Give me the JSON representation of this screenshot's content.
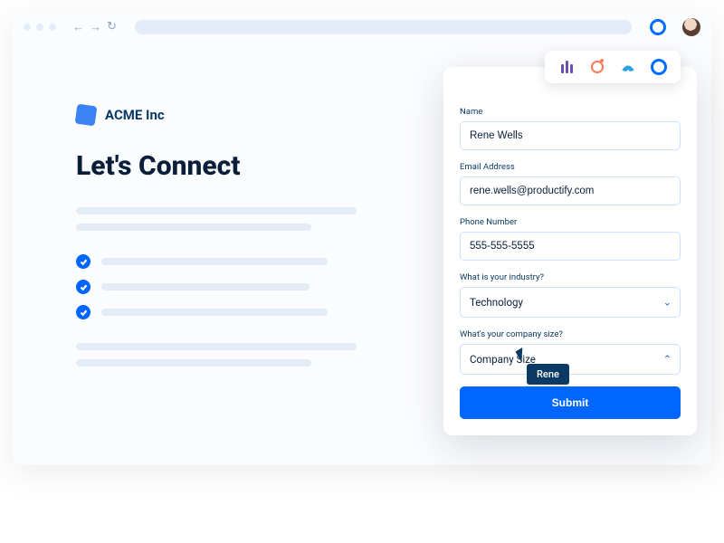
{
  "brand": {
    "name": "ACME Inc"
  },
  "headline": "Let's Connect",
  "form": {
    "name": {
      "label": "Name",
      "value": "Rene Wells"
    },
    "email": {
      "label": "Email Address",
      "value": "rene.wells@productify.com"
    },
    "phone": {
      "label": "Phone Number",
      "value": "555-555-5555"
    },
    "industry": {
      "label": "What is your industry?",
      "value": "Technology"
    },
    "company_size": {
      "label": "What's your company size?",
      "value": "Company Size"
    },
    "submit_label": "Submit"
  },
  "cursor": {
    "label": "Rene"
  }
}
